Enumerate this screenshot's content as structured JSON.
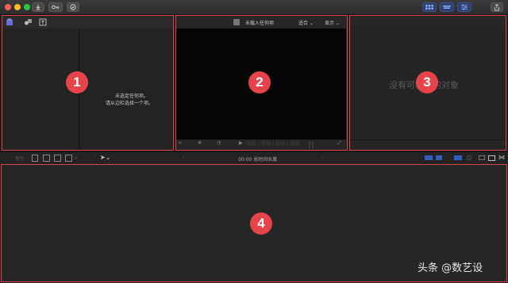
{
  "colors": {
    "accent_red": "#e6434a",
    "window_bg": "#1e1e1e",
    "panel_bg": "#222222",
    "viewer_bg": "#050505",
    "toolbar_blue": "#3d6fd6"
  },
  "browser": {
    "empty_line1": "未选定任何项。",
    "empty_line2": "请从边栏选择一个项。"
  },
  "viewer": {
    "status": "未载入任何项",
    "fit_label": "适合",
    "display_label": "显示",
    "timecode": "00:00:00:00"
  },
  "inspector": {
    "empty_text": "没有可检查的对象"
  },
  "timeline_bar": {
    "duration": "00:00 总时间长度"
  },
  "badges": [
    "1",
    "2",
    "3",
    "4"
  ],
  "watermark": "头条 @数艺设"
}
